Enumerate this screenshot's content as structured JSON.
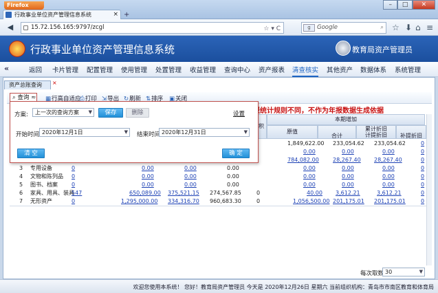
{
  "browser": {
    "app_button": "Firefox",
    "tab_title": "行政事业单位资产管理信息系统",
    "url": "15.72.156.165:9797/zcgl",
    "search_placeholder": "Google",
    "new_tab": "+"
  },
  "app": {
    "title": "行政事业单位资产管理信息系统",
    "user": "教育局资产管理员",
    "menu": [
      "返回",
      "卡片管理",
      "配置管理",
      "使用管理",
      "处置管理",
      "收益管理",
      "查询中心",
      "资产报表",
      "清查核实",
      "其他资产",
      "数据体系",
      "系统管理"
    ],
    "active_menu": "清查核实"
  },
  "page": {
    "tab_title": "资产总账查询",
    "toolbar": {
      "query": "查询",
      "fit_height": "行高自适应",
      "print": "打印",
      "export": "导出",
      "refresh": "刷新",
      "sort": "排序",
      "close": "关闭"
    },
    "banner": "报统计规则不同，不作为年报数据生成依据"
  },
  "query_panel": {
    "scheme_label": "方案:",
    "scheme_value": "上一次的查询方案",
    "save": "保存",
    "delete": "删除",
    "settings": "设置",
    "start_label": "开始时间",
    "start_value": "2020年12月1日",
    "end_label": "结束时间",
    "end_value": "2020年12月31日",
    "clear": "清 空",
    "confirm": "确 定"
  },
  "table": {
    "header_group": "本期增加",
    "col_area": "积",
    "col_original": "原值",
    "col_total": "合计",
    "col_cum_dep": "累计折旧",
    "col_cum_dep_sub": "计提折旧",
    "col_supp_dep": "补提折旧",
    "rows": [
      {
        "no": "",
        "name": "",
        "qty": "",
        "value": "",
        "net": "",
        "area": "",
        "orig": "1,849,622.00",
        "total": "233,054.62",
        "cum": "233,054.62",
        "supp": "0"
      },
      {
        "no": "",
        "name": "",
        "qty": "",
        "value": "",
        "net": "",
        "area": "",
        "orig": "0.00",
        "total": "0.00",
        "cum": "0.00",
        "supp": "0"
      },
      {
        "no": "",
        "name": "",
        "qty": "",
        "value": "",
        "net": "",
        "area": "",
        "orig": "784,082.00",
        "total": "28,267.40",
        "cum": "28,267.40",
        "supp": "0"
      },
      {
        "no": "3",
        "name": "专用设备",
        "qty": "0",
        "value": "0.00",
        "net": "0.00",
        "area": "0.00",
        "orig": "0.00",
        "total": "0.00",
        "cum": "0.00",
        "supp": "0"
      },
      {
        "no": "4",
        "name": "文物和陈列品",
        "qty": "0",
        "value": "0.00",
        "net": "0.00",
        "area": "0.00",
        "orig": "0.00",
        "total": "0.00",
        "cum": "0.00",
        "supp": "0"
      },
      {
        "no": "5",
        "name": "图书、档案",
        "qty": "0",
        "value": "0.00",
        "net": "0.00",
        "area": "0.00",
        "orig": "0.00",
        "total": "0.00",
        "cum": "0.00",
        "supp": "0"
      },
      {
        "no": "6",
        "name": "家具、用具、装具",
        "qty": "547",
        "value": "650,089.00",
        "net": "375,521.15",
        "area": "274,567.85",
        "area2": "0",
        "orig": "40.00",
        "total": "3,612.21",
        "cum": "3,612.21",
        "supp": "0"
      },
      {
        "no": "7",
        "name": "无形资产",
        "qty": "0",
        "value": "1,295,000.00",
        "net": "334,316.70",
        "area": "960,683.30",
        "area2": "0",
        "orig": "1,056,500.00",
        "total": "201,175.01",
        "cum": "201,175.01",
        "supp": "0"
      }
    ]
  },
  "pager": {
    "per_page_label": "每次取数",
    "per_page_value": "30"
  },
  "status": "欢迎您使用本系统！ 您好！教育局资产管理员 今天是 2020年12月26日 星期六 当前组织机构：青岛市市南区教育和体育局"
}
